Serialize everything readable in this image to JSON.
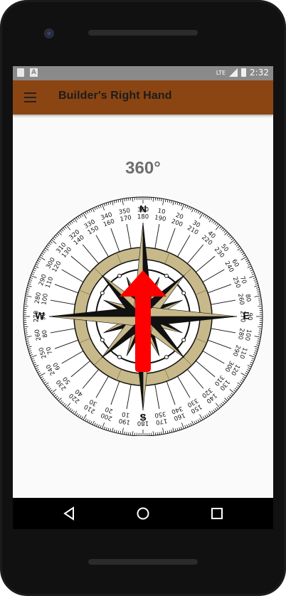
{
  "status_bar": {
    "time": "2:32",
    "network": "LTE",
    "icons": [
      "sd-card-icon",
      "a-notification-icon",
      "signal-icon",
      "battery-icon"
    ],
    "background": "#8a8a8a"
  },
  "app_bar": {
    "title": "Builder's Right Hand",
    "background": "#8b4513"
  },
  "compass": {
    "heading": "360°",
    "heading_degrees": 360,
    "cardinals": {
      "north": "N",
      "east": "E",
      "south": "S",
      "west": "W"
    },
    "arrow_color": "#ff0000",
    "rose_color": "#c8b98a"
  },
  "nav_bar": {
    "buttons": [
      "back-icon",
      "home-icon",
      "recents-icon"
    ]
  }
}
